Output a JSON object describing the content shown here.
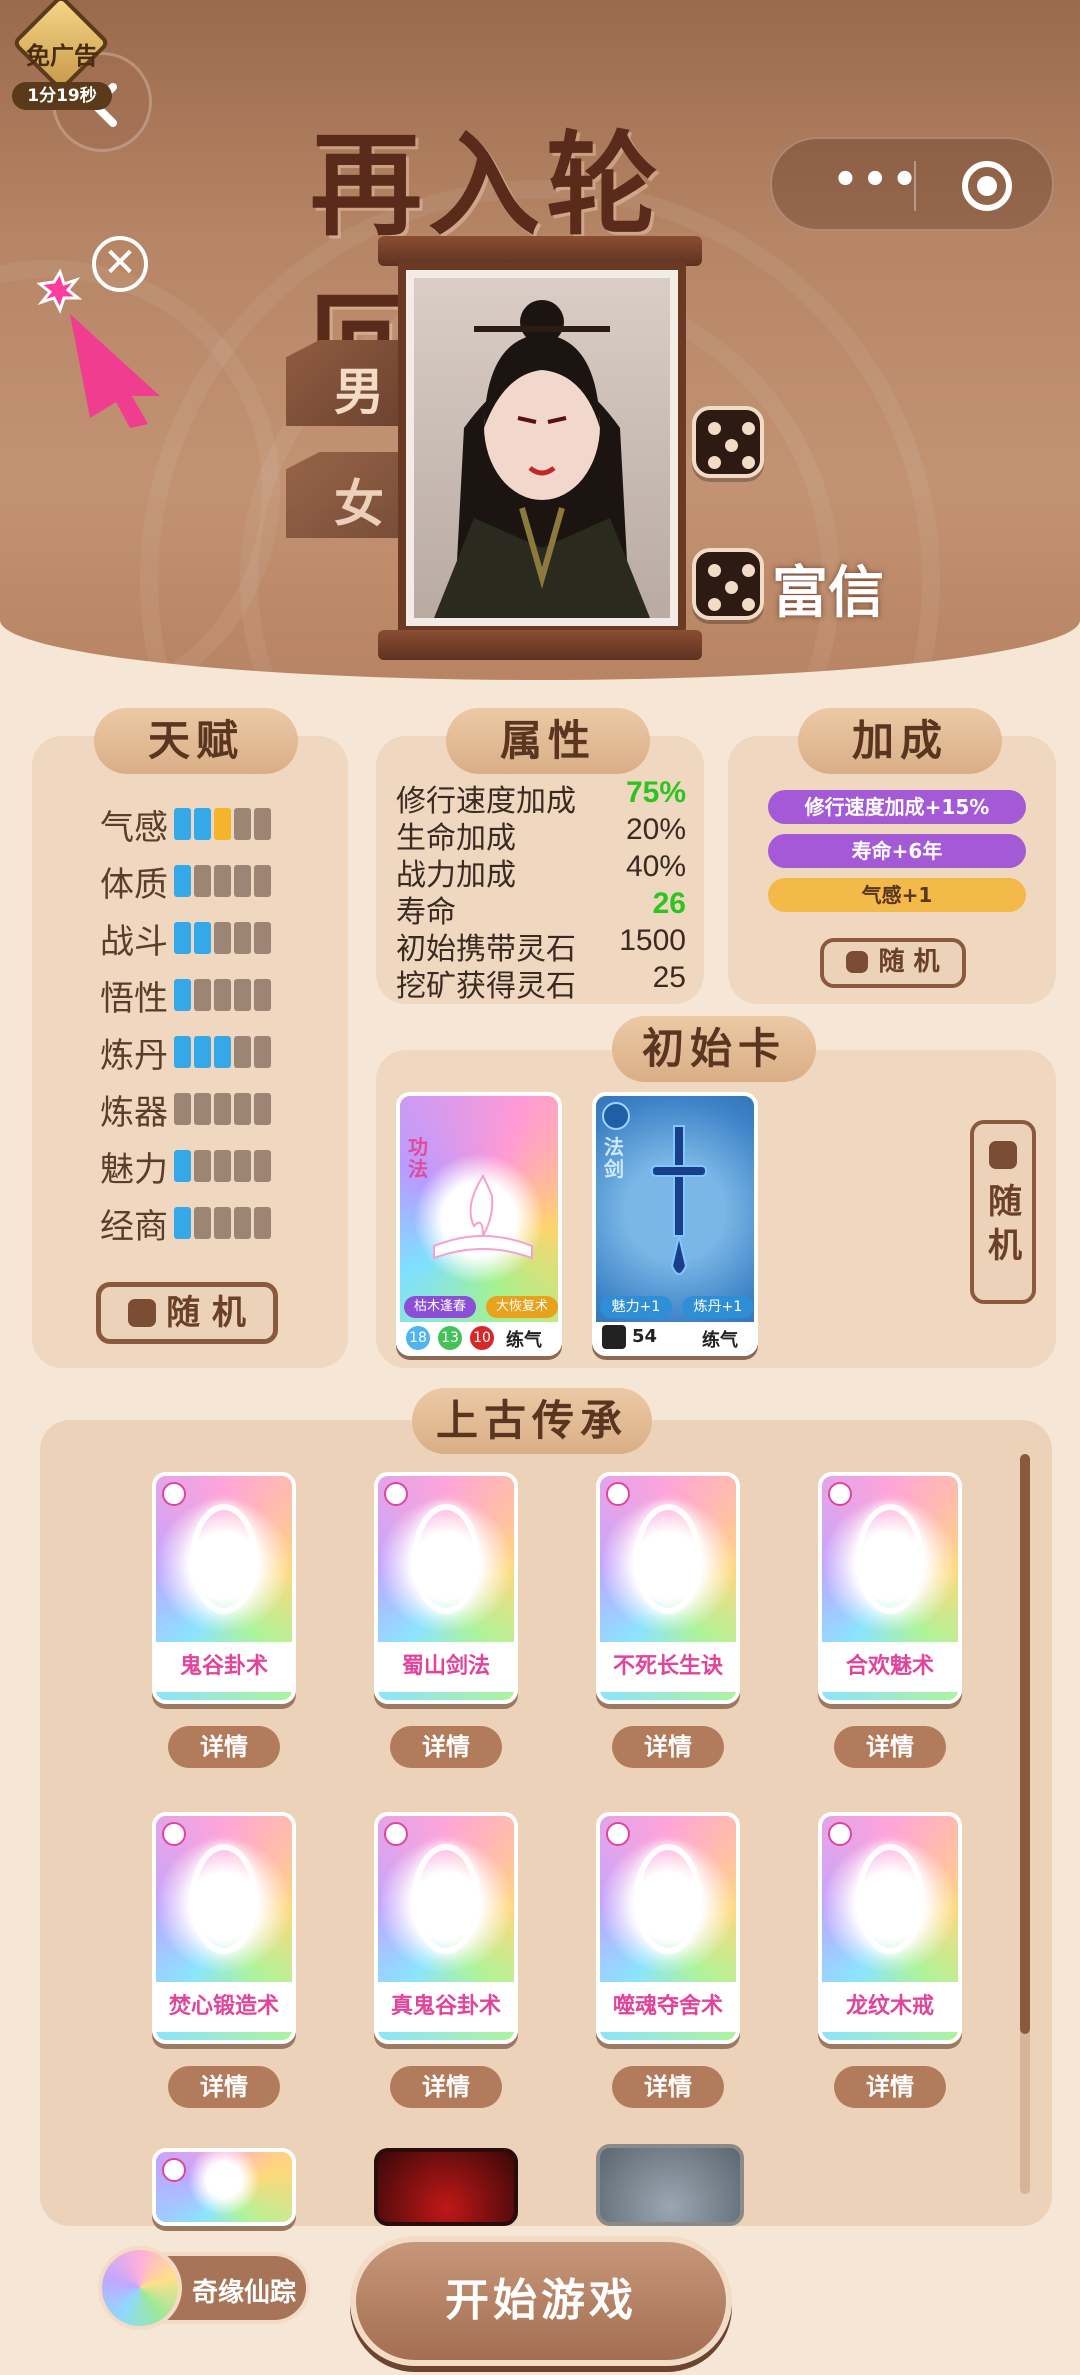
{
  "header": {
    "title": "再入轮回",
    "ad_badge": {
      "label": "免广告",
      "timer": "1分19秒"
    },
    "capsule_more": "•••",
    "close_symbol": "✕",
    "gender_male": "男",
    "gender_female": "女",
    "character_name": "富信"
  },
  "talent": {
    "title": "天赋",
    "rows": [
      {
        "name": "气感",
        "filled": 2,
        "gold": 1
      },
      {
        "name": "体质",
        "filled": 1,
        "gold": 0
      },
      {
        "name": "战斗",
        "filled": 2,
        "gold": 0
      },
      {
        "name": "悟性",
        "filled": 1,
        "gold": 0
      },
      {
        "name": "炼丹",
        "filled": 3,
        "gold": 0
      },
      {
        "name": "炼器",
        "filled": 0,
        "gold": 0
      },
      {
        "name": "魅力",
        "filled": 1,
        "gold": 0
      },
      {
        "name": "经商",
        "filled": 1,
        "gold": 0
      }
    ],
    "random_label": "随 机"
  },
  "attributes": {
    "title": "属性",
    "rows": [
      {
        "key": "修行速度加成",
        "value": "75%",
        "green": true
      },
      {
        "key": "生命加成",
        "value": "20%",
        "green": false
      },
      {
        "key": "战力加成",
        "value": "40%",
        "green": false
      },
      {
        "key": "寿命",
        "value": "26",
        "green": true
      },
      {
        "key": "初始携带灵石",
        "value": "1500",
        "green": false
      },
      {
        "key": "挖矿获得灵石",
        "value": "25",
        "green": false
      }
    ]
  },
  "bonus": {
    "title": "加成",
    "items": [
      "修行速度加成+15%",
      "寿命+6年",
      "气感+1"
    ],
    "random_label": "随 机"
  },
  "initial_cards": {
    "title": "初始卡",
    "card1": {
      "type": "功法",
      "tags": [
        "枯木逢春",
        "大恢复术"
      ],
      "nums": [
        "18",
        "13",
        "10"
      ],
      "realm": "练气"
    },
    "card2": {
      "type": "法剑",
      "tags": [
        "魅力+1",
        "炼丹+1"
      ],
      "power": "54",
      "realm": "练气"
    },
    "random_label": "随机"
  },
  "legacy": {
    "title": "上古传承",
    "cards": [
      "鬼谷卦术",
      "蜀山剑法",
      "不死长生诀",
      "合欢魅术",
      "焚心锻造术",
      "真鬼谷卦术",
      "噬魂夺舍术",
      "龙纹木戒"
    ],
    "detail_label": "详情"
  },
  "footer": {
    "qiyuan_label": "奇缘仙踪",
    "start_label": "开始游戏"
  }
}
